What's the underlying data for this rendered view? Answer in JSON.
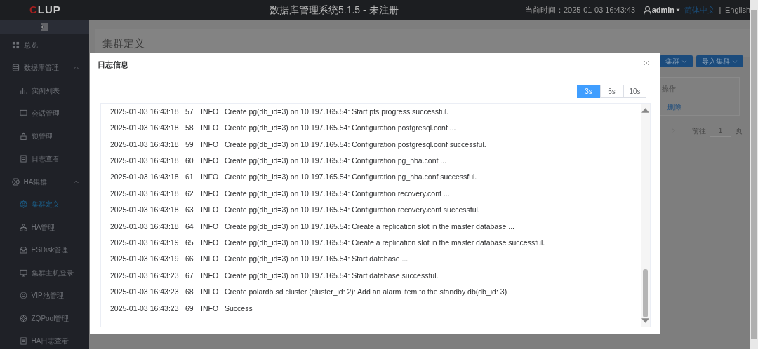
{
  "header": {
    "logo": "CLUP",
    "title": "数据库管理系统5.1.5 - 未注册",
    "time": "当前时间：2025-01-03 16:43:43",
    "user": "admin",
    "languages": [
      {
        "label": "简体中文",
        "selected": true
      },
      {
        "label": "English",
        "selected": false
      }
    ],
    "separator": "|"
  },
  "sidebar": {
    "items": [
      {
        "label": "总览",
        "selected": false
      },
      {
        "label": "数据库管理",
        "selected": false,
        "expanded": true,
        "children": [
          {
            "label": "实例列表",
            "selected": false
          },
          {
            "label": "会话管理",
            "selected": false
          },
          {
            "label": "锁管理",
            "selected": false
          },
          {
            "label": "日志查看",
            "selected": false
          }
        ]
      },
      {
        "label": "HA集群",
        "selected": false,
        "expanded": true,
        "children": [
          {
            "label": "集群定义",
            "selected": true
          },
          {
            "label": "HA管理",
            "selected": false
          },
          {
            "label": "ESDisk管理",
            "selected": false
          },
          {
            "label": "集群主机登录",
            "selected": false
          },
          {
            "label": "VIP池管理",
            "selected": false
          },
          {
            "label": "ZQPool管理",
            "selected": false
          },
          {
            "label": "HA日志查看",
            "selected": false
          }
        ]
      }
    ]
  },
  "page": {
    "title": "集群定义",
    "buttons": [
      "集群",
      "导入集群"
    ],
    "table": {
      "header": "操作",
      "action": "删除"
    },
    "pagination": {
      "goto": "前往",
      "page": "1",
      "unit": "页"
    }
  },
  "dialog": {
    "title": "日志信息",
    "intervals": [
      {
        "label": "3s",
        "selected": true
      },
      {
        "label": "5s",
        "selected": false
      },
      {
        "label": "10s",
        "selected": false
      }
    ],
    "log": [
      {
        "time": "2025-01-03 16:43:18",
        "seq": "57",
        "level": "INFO",
        "message": "Create pg(db_id=3) on 10.197.165.54: Start pfs progress successful."
      },
      {
        "time": "2025-01-03 16:43:18",
        "seq": "58",
        "level": "INFO",
        "message": "Create pg(db_id=3) on 10.197.165.54: Configuration postgresql.conf ..."
      },
      {
        "time": "2025-01-03 16:43:18",
        "seq": "59",
        "level": "INFO",
        "message": "Create pg(db_id=3) on 10.197.165.54: Configuration postgresql.conf successful."
      },
      {
        "time": "2025-01-03 16:43:18",
        "seq": "60",
        "level": "INFO",
        "message": "Create pg(db_id=3) on 10.197.165.54: Configuration pg_hba.conf ..."
      },
      {
        "time": "2025-01-03 16:43:18",
        "seq": "61",
        "level": "INFO",
        "message": "Create pg(db_id=3) on 10.197.165.54: Configuration pg_hba.conf successful."
      },
      {
        "time": "2025-01-03 16:43:18",
        "seq": "62",
        "level": "INFO",
        "message": "Create pg(db_id=3) on 10.197.165.54: Configuration recovery.conf ..."
      },
      {
        "time": "2025-01-03 16:43:18",
        "seq": "63",
        "level": "INFO",
        "message": "Create pg(db_id=3) on 10.197.165.54: Configuration recovery.conf successful."
      },
      {
        "time": "2025-01-03 16:43:18",
        "seq": "64",
        "level": "INFO",
        "message": "Create pg(db_id=3) on 10.197.165.54: Create a replication slot in the master database ..."
      },
      {
        "time": "2025-01-03 16:43:19",
        "seq": "65",
        "level": "INFO",
        "message": "Create pg(db_id=3) on 10.197.165.54: Create a replication slot in the master database successful."
      },
      {
        "time": "2025-01-03 16:43:19",
        "seq": "66",
        "level": "INFO",
        "message": "Create pg(db_id=3) on 10.197.165.54: Start database ..."
      },
      {
        "time": "2025-01-03 16:43:23",
        "seq": "67",
        "level": "INFO",
        "message": "Create pg(db_id=3) on 10.197.165.54: Start database successful."
      },
      {
        "time": "2025-01-03 16:43:23",
        "seq": "68",
        "level": "INFO",
        "message": "Create polardb sd cluster (cluster_id: 2): Add an alarm item to the standby db(db_id: 3)"
      },
      {
        "time": "2025-01-03 16:43:23",
        "seq": "69",
        "level": "INFO",
        "message": "Success"
      }
    ]
  }
}
